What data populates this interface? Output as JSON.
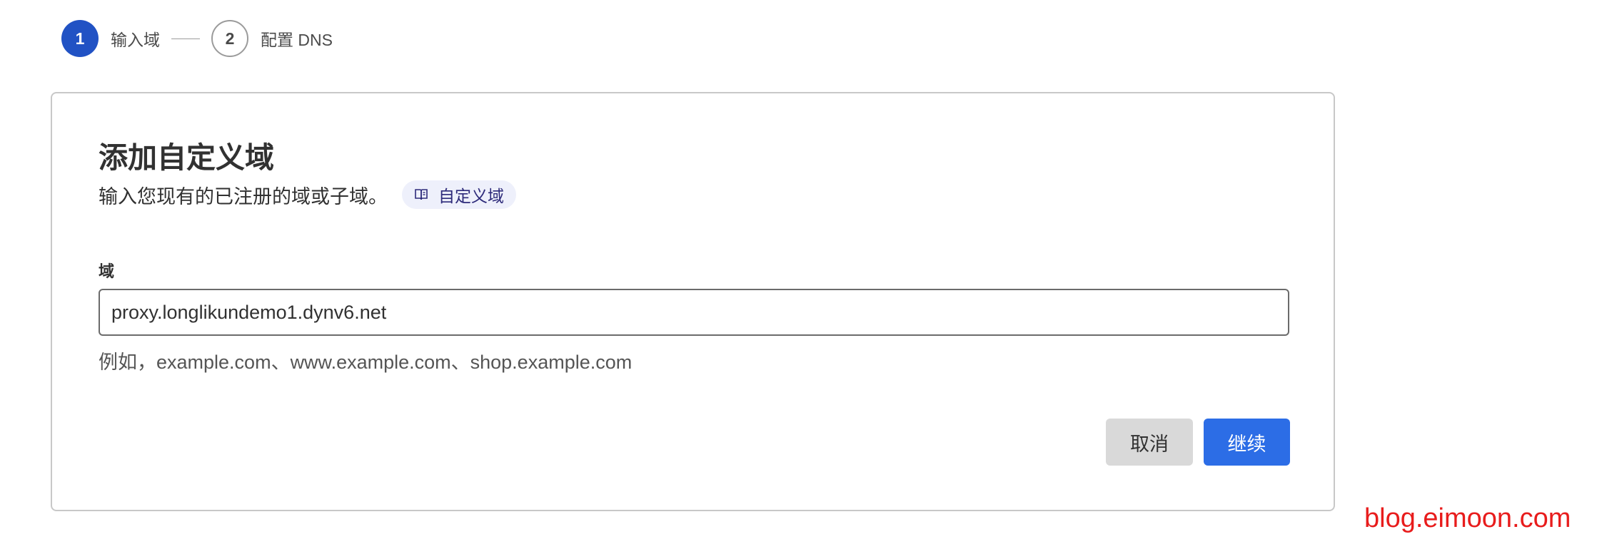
{
  "stepper": {
    "steps": [
      {
        "number": "1",
        "label": "输入域",
        "state": "active"
      },
      {
        "number": "2",
        "label": "配置 DNS",
        "state": "inactive"
      }
    ]
  },
  "card": {
    "title": "添加自定义域",
    "subtitle": "输入您现有的已注册的域或子域。",
    "doc_link": {
      "label": "自定义域",
      "icon": "book-icon"
    },
    "field": {
      "label": "域",
      "value": "proxy.longlikundemo1.dynv6.net",
      "hint": "例如，example.com、www.example.com、shop.example.com"
    },
    "buttons": {
      "cancel": "取消",
      "continue": "继续"
    }
  },
  "watermark": "blog.eimoon.com",
  "colors": {
    "accent": "#2152c4",
    "primary_button": "#2c6de6",
    "chip_bg": "#eef0fb",
    "watermark": "#e81c1c"
  }
}
